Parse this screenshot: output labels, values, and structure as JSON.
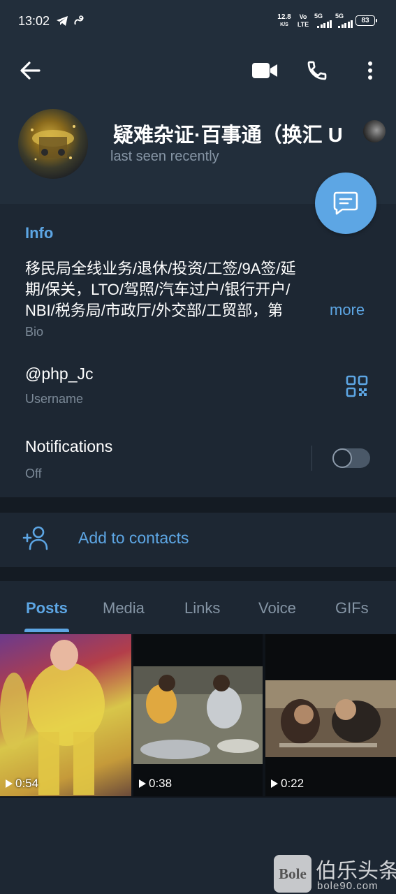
{
  "status_bar": {
    "time": "13:02",
    "net_speed_value": "12.8",
    "net_speed_unit": "K/S",
    "volte_top": "Vo",
    "volte_bottom": "LTE",
    "sim1": "5G",
    "sim2": "5G",
    "battery": "83"
  },
  "header": {
    "back_icon": "arrow-left-icon",
    "video_call_icon": "video-camera-icon",
    "call_icon": "phone-icon",
    "menu_icon": "more-vertical-icon",
    "name": "疑难杂证·百事通（换汇 U",
    "last_seen": "last seen recently",
    "fab_icon": "message-icon"
  },
  "info": {
    "section_title": "Info",
    "bio_line1": "移民局全线业务/退休/投资/工签/9A签/延",
    "bio_line2": "期/保关，LTO/驾照/汽车过户/银行开户/",
    "bio_line3": "NBI/税务局/市政厅/外交部/工贸部，第",
    "more_label": "more",
    "bio_label": "Bio",
    "username": "@php_Jc",
    "username_label": "Username",
    "qr_icon": "qr-code-icon",
    "notifications_label": "Notifications",
    "notifications_value": "Off",
    "notifications_on": false
  },
  "contacts": {
    "icon": "add-user-icon",
    "label": "Add to contacts"
  },
  "tabs": [
    {
      "label": "Posts",
      "active": true
    },
    {
      "label": "Media",
      "active": false
    },
    {
      "label": "Links",
      "active": false
    },
    {
      "label": "Voice",
      "active": false
    },
    {
      "label": "GIFs",
      "active": false
    }
  ],
  "media": [
    {
      "duration": "0:54"
    },
    {
      "duration": "0:38"
    },
    {
      "duration": "0:22"
    }
  ],
  "watermark": {
    "logo": "Bole",
    "text": "伯乐头条",
    "url": "bole90.com"
  },
  "colors": {
    "accent": "#5da6e4",
    "header_bg": "#222e3b",
    "section_bg": "#1d2733",
    "divider_bg": "#141b23"
  }
}
